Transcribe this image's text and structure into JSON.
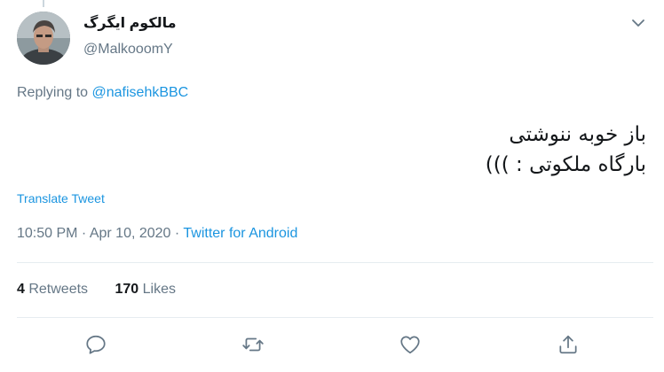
{
  "tweet": {
    "author": {
      "display_name": "مالکوم ایگرگ",
      "handle": "@MalkooomY"
    },
    "reply": {
      "prefix": "Replying to ",
      "mention": "@nafisehkBBC"
    },
    "text_lines": [
      "باز خوبه ننوشتی",
      "بارگاه ملکوتی : )))"
    ],
    "translate_label": "Translate Tweet",
    "time": "10:50 PM",
    "separator": " · ",
    "date": "Apr 10, 2020",
    "source": "Twitter for Android",
    "retweets": {
      "count": "4",
      "label": " Retweets"
    },
    "likes": {
      "count": "170",
      "label": " Likes"
    }
  },
  "icons": {
    "caret": "chevron-down-icon",
    "reply": "reply-icon",
    "retweet": "retweet-icon",
    "like": "heart-icon",
    "share": "share-icon"
  },
  "colors": {
    "link": "#1b95e0",
    "secondary_text": "#657786",
    "icon": "#657786",
    "divider": "#e6ecf0"
  }
}
